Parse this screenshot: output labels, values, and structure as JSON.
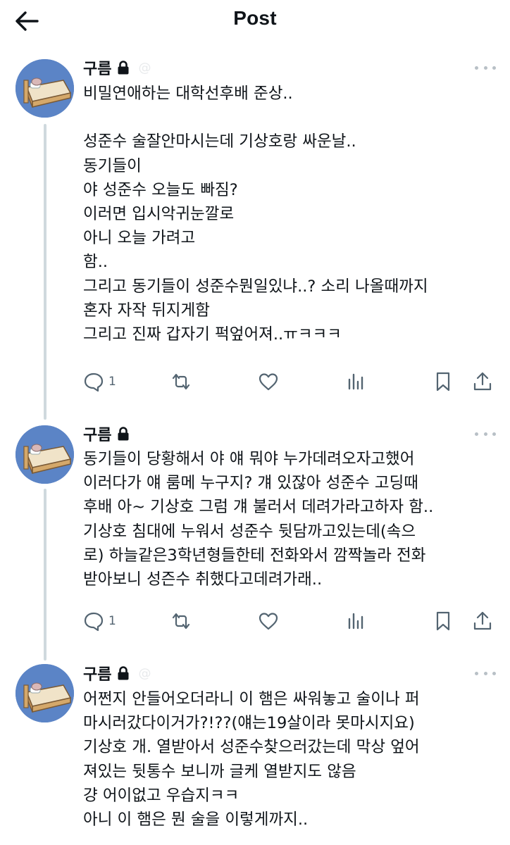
{
  "header": {
    "title": "Post",
    "back_icon": "arrow-left-icon"
  },
  "posts": [
    {
      "author": "구름",
      "lock_icon": "lock-icon",
      "handle": "@",
      "text": "비밀연애하는 대학선후배 준상..\n\n성준수 술잘안마시는데 기상호랑 싸운날..\n동기들이\n야 성준수 오늘도 빠짐?\n이러면 입시악귀눈깔로\n아니 오늘 가려고\n함..\n그리고 동기들이 성준수뭔일있냐..? 소리 나올때까지\n혼자 자작 뒤지게함\n그리고 진짜 갑자기 퍽엎어져..ㅠㅋㅋㅋ",
      "reply_count": "1"
    },
    {
      "author": "구름",
      "lock_icon": "lock-icon",
      "handle": "",
      "text": "동기들이 당황해서 야 얘 뭐야 누가데려오자고했어\n이러다가 얘 룸메 누구지? 걔 있잖아 성준수 고딩때\n후배 아~ 기상호 그럼 걔 불러서 데려가라고하자 함..\n기상호 침대에 누워서 성준수 뒷담까고있는데(속으\n로) 하늘같은3학년형들한테 전화와서 깜짝놀라 전화\n받아보니 성즌수 취했다고데려가래..",
      "reply_count": "1"
    },
    {
      "author": "구름",
      "lock_icon": "lock-icon",
      "handle": "@",
      "text": "어쩐지 안들어오더라니 이 햄은 싸워놓고 술이나 퍼\n마시러갔다이거가?!??(얘는19살이라 못마시지요)\n기상호 개. 열받아서 성준수찾으러갔는데 막상 엎어\n져있는 뒷통수 보니까 글케 열받지도 않음\n걍 어이없고 우습지ㅋㅋ\n아니 이 햄은 뭔 술을 이렇게까지.."
    }
  ],
  "action_icons": [
    "reply-icon",
    "repost-icon",
    "like-icon",
    "views-icon",
    "bookmark-icon",
    "share-icon"
  ],
  "colors": {
    "avatar_bg": "#5b84c6",
    "text": "#0f1419",
    "icon": "#536471",
    "thread_line": "#cfd9de"
  }
}
